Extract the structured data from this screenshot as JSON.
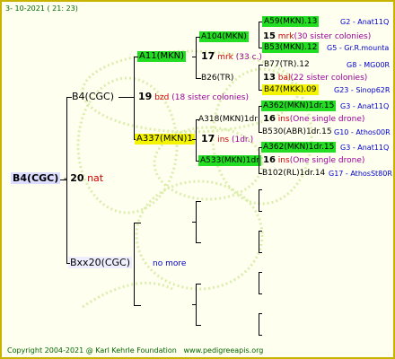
{
  "header": {
    "date": "3- 10-2021 ( 21: 23)"
  },
  "footer": {
    "copyright": "Copyright 2004-2021 @ Karl Kehrle Foundation",
    "site": "www.pedigreeapis.org"
  },
  "colors": {
    "green_box": "#22dd22",
    "yellow_box": "#f4f400",
    "blue_text": "#0000cc",
    "red_text": "#cc0000",
    "purple_text": "#990099",
    "border": "#c8b400",
    "background": "#fffff0"
  },
  "root": {
    "name": "B4(CGC)",
    "code": "20",
    "note": "nat"
  },
  "gen1": [
    {
      "name": "B4(CGC)",
      "code": "19",
      "note": "bzd",
      "extra": "(18 sister colonies)"
    },
    {
      "name": "Bxx20(CGC)",
      "extra": "no more"
    }
  ],
  "gen2": [
    {
      "name": "A11(MKN)",
      "code": "17",
      "note": "mrk",
      "extra": "(33 c.)"
    },
    {
      "name": "A337(MKN)1",
      "code": "17",
      "note": "ins",
      "extra": "(1dr.)"
    }
  ],
  "gen3": [
    {
      "name": "A104(MKN)",
      "code": "15",
      "note": "mrk",
      "extra": "(30 sister colonies)"
    },
    {
      "name": "B26(TR)",
      "code": "13",
      "note": "bal",
      "extra": "(22 sister colonies)"
    },
    {
      "name": "A318(MKN)1dr",
      "code": "16",
      "note": "ins",
      "extra": "(One single drone)"
    },
    {
      "name": "A533(MKN)1dr",
      "code": "16",
      "note": "ins",
      "extra": "(One single drone)"
    }
  ],
  "gen4": [
    {
      "name": "A59(MKN).13",
      "tag": "G2 - Anat11Q"
    },
    {
      "name": "B53(MKN).12",
      "tag": "G5 - Gr.R.mounta"
    },
    {
      "name": "B77(TR).12",
      "tag": "G8 - MG00R"
    },
    {
      "name": "B47(MKK).09",
      "tag": "G23 - Sinop62R"
    },
    {
      "name": "A362(MKN)1dr.15",
      "tag": "G3 - Anat11Q"
    },
    {
      "name": "B530(ABR)1dr.15",
      "tag": "G10 - Athos00R"
    },
    {
      "name": "A362(MKN)1dr.15",
      "tag": "G3 - Anat11Q"
    },
    {
      "name": "B102(RL)1dr.14",
      "tag": "G17 - AthosSt80R"
    }
  ]
}
